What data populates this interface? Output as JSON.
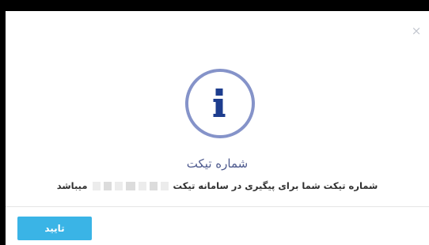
{
  "dialog": {
    "close_glyph": "×",
    "icon": "info-icon",
    "title": "شماره تیکت",
    "message_prefix": "شماره تیکت شما برای پیگیری در سامانه تیکت",
    "message_suffix": "میباشد",
    "confirm_label": "تایید"
  },
  "colors": {
    "accent_ring": "#8593c9",
    "info_glyph": "#1d3d8e",
    "title_text": "#4e5a8e",
    "button": "#3ab4e6"
  }
}
